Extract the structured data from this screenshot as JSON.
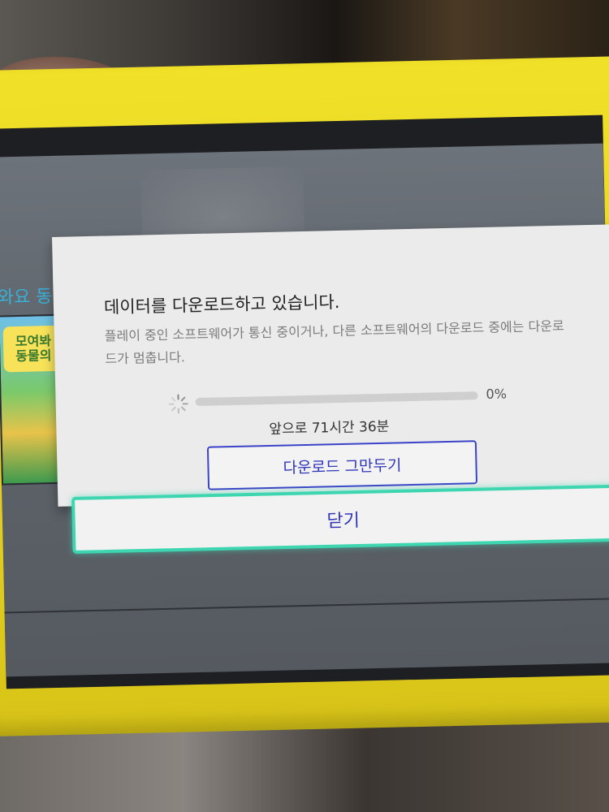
{
  "home": {
    "partial_heading": "와요 동",
    "game_logo": "모여봐\n동물의"
  },
  "dialog": {
    "title": "데이터를 다운로드하고 있습니다.",
    "description": "플레이 중인 소프트웨어가 통신 중이거나, 다른 소프트웨어의 다운로드 중에는 다운로드가 멈춥니다.",
    "progress": {
      "percent_label": "0%",
      "fraction": 0
    },
    "remaining_time": "앞으로 71시간 36분",
    "stop_button_label": "다운로드 그만두기",
    "close_button_label": "닫기"
  },
  "colors": {
    "console_shell": "#e6d220",
    "button_text": "#2f36b8",
    "focus_outline": "#3ed6b0",
    "dialog_bg": "#ebebeb"
  },
  "icons": {
    "spinner": "loading-spinner-icon"
  }
}
